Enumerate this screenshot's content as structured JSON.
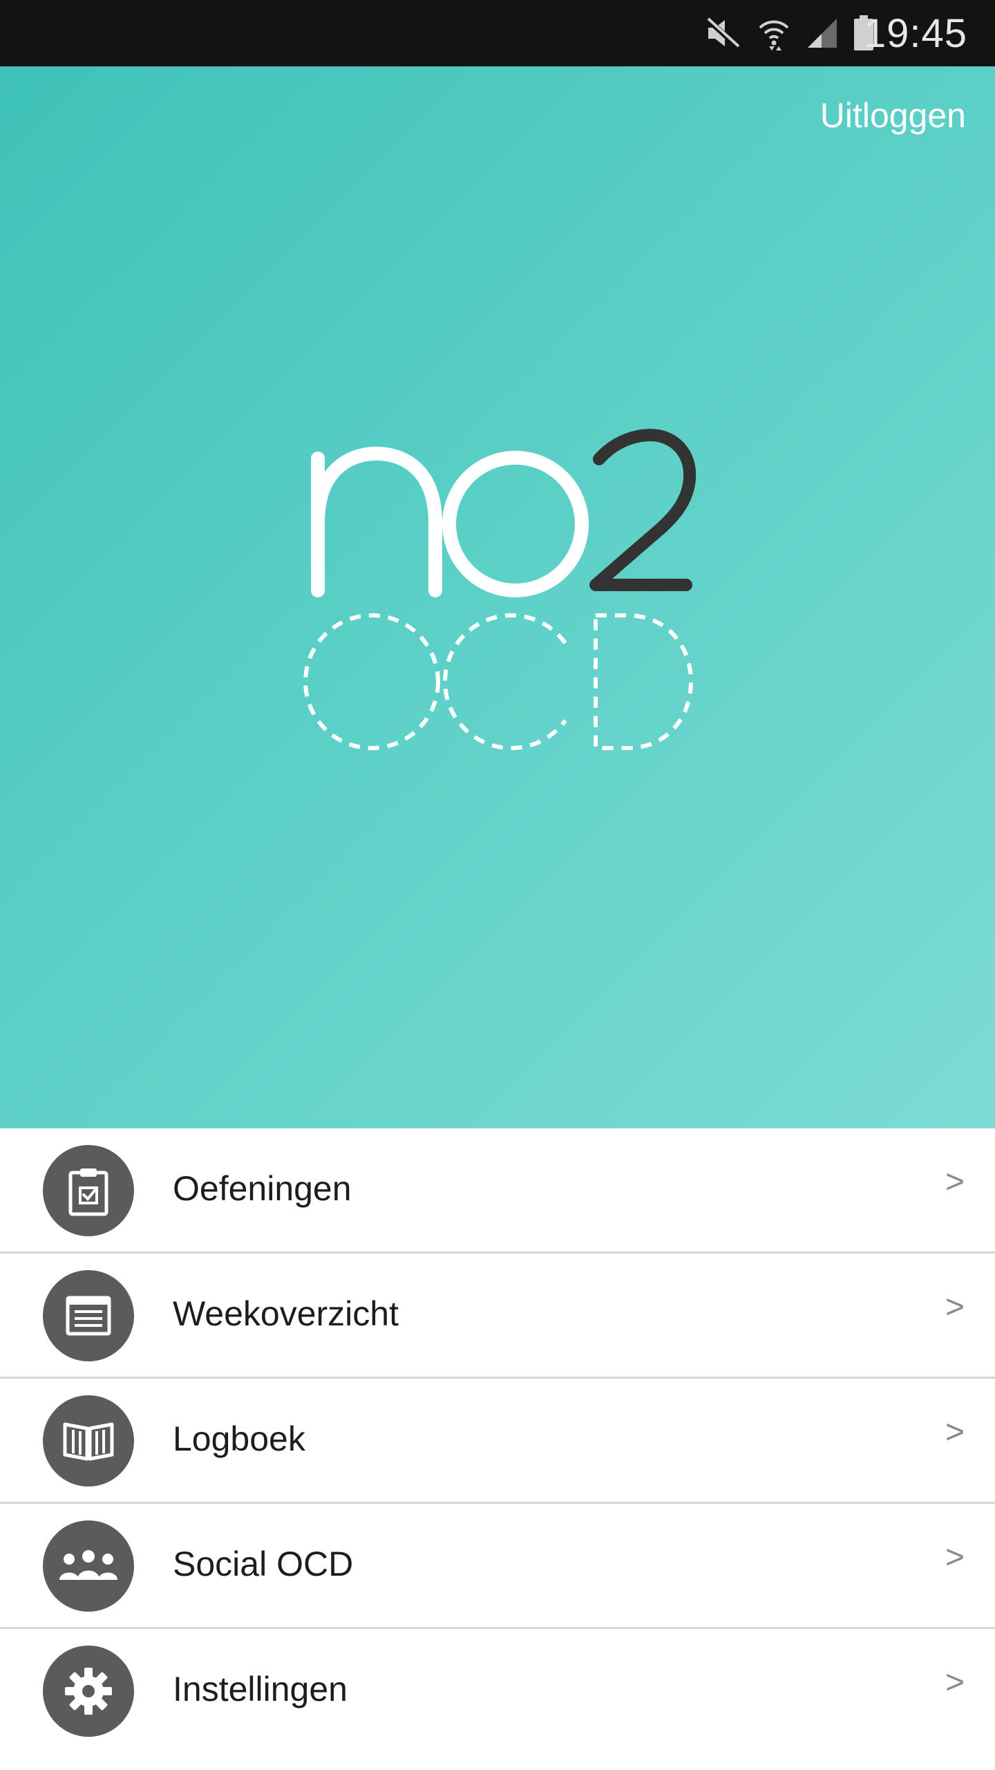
{
  "status_bar": {
    "time": "19:45",
    "icons": [
      "mute-icon",
      "wifi-icon",
      "signal-icon",
      "battery-icon"
    ]
  },
  "header": {
    "logout_label": "Uitloggen"
  },
  "logo": {
    "line1_text": "no",
    "line1_accent": "2",
    "line2_text": "OCD"
  },
  "menu": {
    "items": [
      {
        "label": "Oefeningen",
        "icon": "clipboard-check-icon",
        "chevron": ">"
      },
      {
        "label": "Weekoverzicht",
        "icon": "calendar-list-icon",
        "chevron": ">"
      },
      {
        "label": "Logboek",
        "icon": "open-book-icon",
        "chevron": ">"
      },
      {
        "label": "Social OCD",
        "icon": "people-group-icon",
        "chevron": ">"
      },
      {
        "label": "Instellingen",
        "icon": "gear-icon",
        "chevron": ">"
      }
    ]
  },
  "colors": {
    "status_bar_bg": "#131313",
    "hero_gradient_start": "#3fc2b9",
    "hero_gradient_end": "#7ddcd5",
    "icon_circle": "#5b5b5b",
    "divider": "#d6d6d6",
    "logo_white": "#ffffff",
    "logo_dark": "#333333"
  }
}
